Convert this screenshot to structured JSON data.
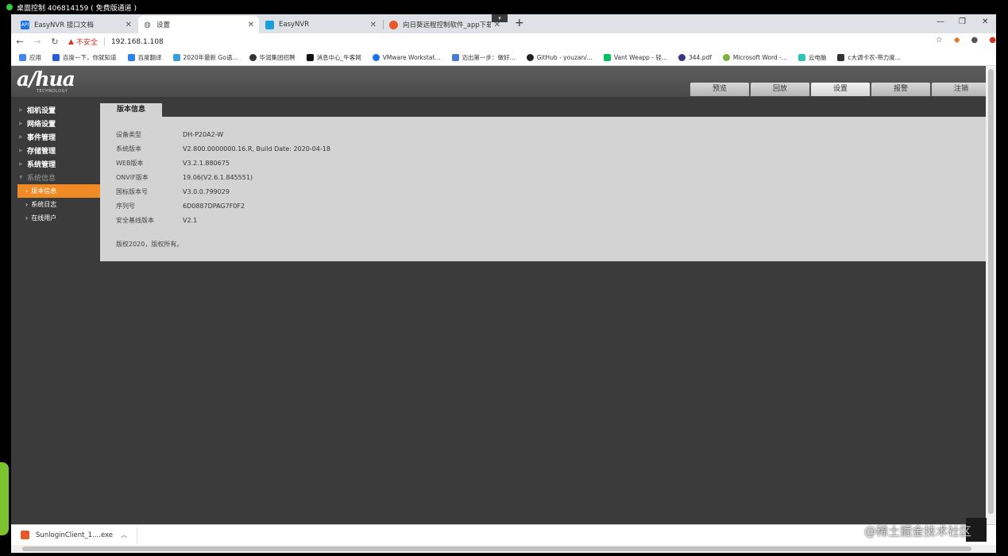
{
  "remote": {
    "title": "桌面控制 406814159 ( 免费版通道 )"
  },
  "tabs": [
    {
      "label": "EasyNVR 接口文档",
      "icon": "api-icon",
      "color": "#1a73e8",
      "active": false
    },
    {
      "label": "设置",
      "icon": "globe-icon",
      "color": "#5f6368",
      "active": true
    },
    {
      "label": "EasyNVR",
      "icon": "easynvr-icon",
      "color": "#1a9fd8",
      "active": false
    },
    {
      "label": "向日葵远程控制软件_app下载_",
      "icon": "sunlogin-icon",
      "color": "#e8562a",
      "active": false
    }
  ],
  "address": {
    "insecure_label": "不安全",
    "url": "192.168.1.108"
  },
  "bookmarks": [
    {
      "label": "应用",
      "color": "#4285f4"
    },
    {
      "label": "百度一下，你就知道",
      "color": "#2b5cd6"
    },
    {
      "label": "百度翻译",
      "color": "#2b82e8"
    },
    {
      "label": "2020年最新 Go语...",
      "color": "#3a9fd8"
    },
    {
      "label": "华润集团招聘",
      "color": "#333333"
    },
    {
      "label": "消息中心_牛客网",
      "color": "#111111"
    },
    {
      "label": "VMware Workstat...",
      "color": "#1a73e8"
    },
    {
      "label": "迈出第一步：做好...",
      "color": "#4a7bd0"
    },
    {
      "label": "GitHub - youzan/...",
      "color": "#222222"
    },
    {
      "label": "Vant Weapp - 轻...",
      "color": "#07c160"
    },
    {
      "label": "344.pdf",
      "color": "#3a3380"
    },
    {
      "label": "Microsoft Word -...",
      "color": "#7bb33a"
    },
    {
      "label": "云电脑",
      "color": "#2ec4b6"
    },
    {
      "label": "c大调卡农-带力度...",
      "color": "#333333"
    }
  ],
  "header": {
    "logo": "a/hua",
    "logo_sub": "TECHNOLOGY",
    "nav": [
      {
        "label": "预览",
        "active": false
      },
      {
        "label": "回放",
        "active": false
      },
      {
        "label": "设置",
        "active": true
      },
      {
        "label": "报警",
        "active": false
      },
      {
        "label": "注销",
        "active": false
      }
    ]
  },
  "sidebar": {
    "items": [
      {
        "label": "相机设置"
      },
      {
        "label": "网络设置"
      },
      {
        "label": "事件管理"
      },
      {
        "label": "存储管理"
      },
      {
        "label": "系统管理"
      },
      {
        "label": "系统信息"
      }
    ],
    "subitems": [
      {
        "label": "版本信息",
        "active": true
      },
      {
        "label": "系统日志",
        "active": false
      },
      {
        "label": "在线用户",
        "active": false
      }
    ]
  },
  "panel": {
    "tab_label": "版本信息",
    "rows": [
      {
        "label": "设备类型",
        "value": "DH-P20A2-W"
      },
      {
        "label": "系统版本",
        "value": "V2.800.0000000.16.R, Build Date: 2020-04-18"
      },
      {
        "label": "WEB版本",
        "value": "V3.2.1.880675"
      },
      {
        "label": "ONVIF版本",
        "value": "19.06(V2.6.1.845551)"
      },
      {
        "label": "国标版本号",
        "value": "V3.0.0.799029"
      },
      {
        "label": "序列号",
        "value": "6D0887DPAG7F0F2"
      },
      {
        "label": "安全基线版本",
        "value": "V2.1"
      }
    ],
    "copyright": "版权2020，版权所有。"
  },
  "download": {
    "filename": "SunloginClient_1....exe"
  },
  "watermark": "@稀土掘金技术社区"
}
